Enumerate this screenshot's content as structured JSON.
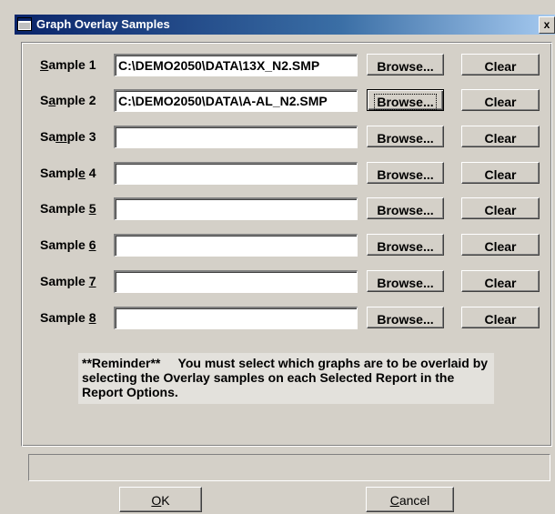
{
  "window": {
    "title": "Graph Overlay Samples",
    "close_glyph": "x",
    "title_icon": "window-icon"
  },
  "samples": [
    {
      "prefix": "S",
      "accel": "",
      "rest": "ample 1",
      "label_pre": "",
      "label_ul": "S",
      "label_post": "ample 1",
      "path": "C:\\DEMO2050\\DATA\\13X_N2.SMP"
    },
    {
      "label_pre": "S",
      "label_ul": "a",
      "label_post": "mple 2",
      "path": "C:\\DEMO2050\\DATA\\A-AL_N2.SMP"
    },
    {
      "label_pre": "Sa",
      "label_ul": "m",
      "label_post": "ple 3",
      "path": ""
    },
    {
      "label_pre": "Sampl",
      "label_ul": "e",
      "label_post": " 4",
      "path": ""
    },
    {
      "label_pre": "Sample ",
      "label_ul": "5",
      "label_post": "",
      "path": ""
    },
    {
      "label_pre": "Sample ",
      "label_ul": "6",
      "label_post": "",
      "path": ""
    },
    {
      "label_pre": "Sample ",
      "label_ul": "7",
      "label_post": "",
      "path": ""
    },
    {
      "label_pre": "Sample ",
      "label_ul": "8",
      "label_post": "",
      "path": ""
    }
  ],
  "buttons": {
    "browse_label": "Browse...",
    "clear_label": "Clear",
    "focused_browse_row": 2
  },
  "reminder": {
    "text": "**Reminder**     You must select which graphs are to be overlaid by selecting the Overlay samples on each Selected Report in the Report Options."
  },
  "status_text": "",
  "footer": {
    "ok_pre": "",
    "ok_ul": "O",
    "ok_post": "K",
    "cancel_pre": "",
    "cancel_ul": "C",
    "cancel_post": "ancel"
  },
  "colors": {
    "face": "#d4d0c8",
    "title_start": "#0a246a",
    "title_end": "#a6caf0",
    "reminder_bg": "#e3e1dc"
  }
}
